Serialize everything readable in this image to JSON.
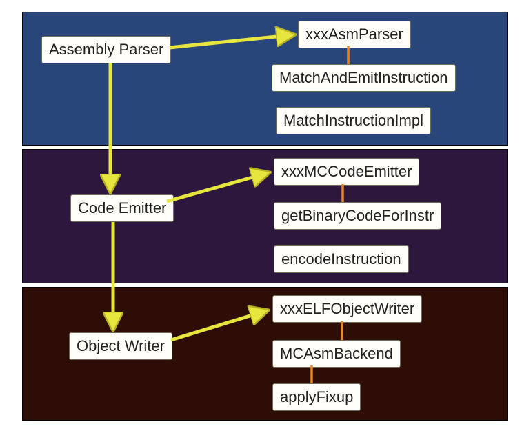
{
  "stages": {
    "stage1": {
      "main": "Assembly Parser",
      "detail1": "xxxAsmParser",
      "detail2": "MatchAndEmitInstruction",
      "detail3": "MatchInstructionImpl"
    },
    "stage2": {
      "main": "Code Emitter",
      "detail1": "xxxMCCodeEmitter",
      "detail2": "getBinaryCodeForInstr",
      "detail3": "encodeInstruction"
    },
    "stage3": {
      "main": "Object Writer",
      "detail1": "xxxELFObjectWriter",
      "detail2": "MCAsmBackend",
      "detail3": "applyFixup"
    }
  },
  "colors": {
    "stage1_bg": "#29467b",
    "stage2_bg": "#2e173c",
    "stage3_bg": "#2f0d07",
    "node_bg": "#fffef8",
    "arrow": "#e7e63f",
    "connector": "#ea8723"
  }
}
